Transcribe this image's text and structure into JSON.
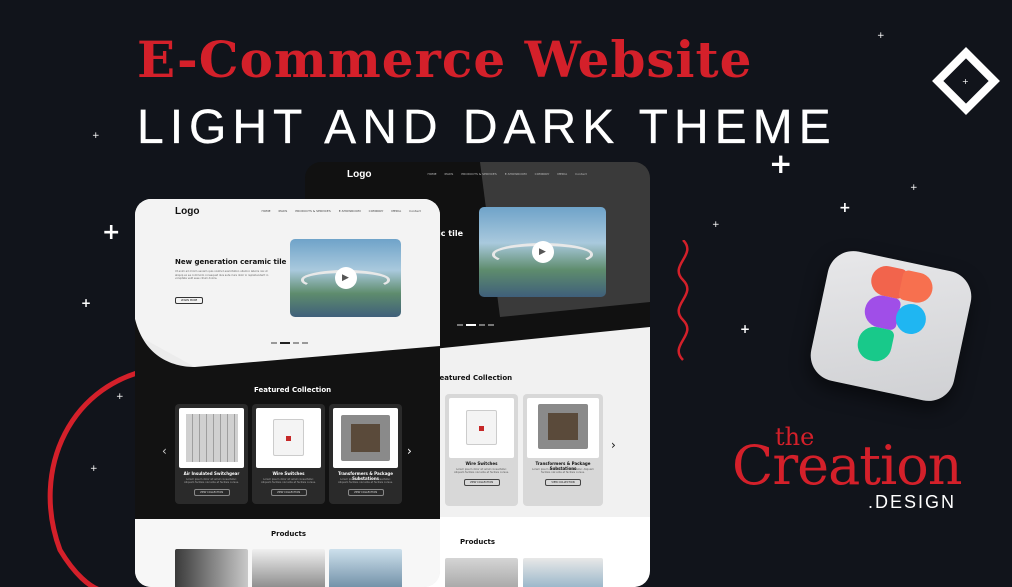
{
  "headline": {
    "line1": "E-Commerce Website",
    "line2": "LIGHT AND DARK THEME"
  },
  "brand": {
    "the": "the",
    "creation": "Creation",
    "design": ".DESIGN"
  },
  "dark_mockup": {
    "logo": "Logo",
    "nav": [
      "HOME",
      "IPADS",
      "PRODUCTS & SERVICES",
      "E-SHOWROOM",
      "COMPANY",
      "MEDIA",
      "Contact"
    ],
    "hero_title_partial": "ic tile",
    "featured_title": "Featured Collection",
    "cards": [
      {
        "title": "Wire Switches",
        "desc": "Lorem ipsum dolor sit amet consectetur. Aliquam facilisis nisl ante et facilisis cursus.",
        "button": "VIEW COLLECTION"
      },
      {
        "title": "Transformers & Package Substations",
        "desc": "Lorem ipsum dolor sit amet consectetur. Aliquam facilisis nisl ante et facilisis cursus.",
        "button": "VIEW COLLECTION"
      }
    ],
    "next_arrow": "›",
    "products_title": "Products"
  },
  "light_mockup": {
    "logo": "Logo",
    "nav": [
      "HOME",
      "IPADS",
      "PRODUCTS & SERVICES",
      "E-SHOWROOM",
      "COMPANY",
      "MEDIA",
      "Contact"
    ],
    "hero_title": "New generation ceramic tile",
    "hero_desc": "Ut enim ad minim veniam quis nostrud exercitation ullamco laboris nisi ut aliquip ex ea commodo consequat duis aute irure dolor in reprehenderit in voluptate velit esse cillum dolore.",
    "hero_button": "LEARN MORE",
    "featured_title": "Featured Collection",
    "cards": [
      {
        "title": "Air Insulated Switchgear",
        "desc": "Lorem ipsum dolor sit amet consectetur. Aliquam facilisis nisl ante et facilisis cursus.",
        "button": "VIEW COLLECTION"
      },
      {
        "title": "Wire Switches",
        "desc": "Lorem ipsum dolor sit amet consectetur. Aliquam facilisis nisl ante et facilisis cursus.",
        "button": "VIEW COLLECTION"
      },
      {
        "title": "Transformers & Package Substations",
        "desc": "Lorem ipsum dolor sit amet consectetur. Aliquam facilisis nisl ante et facilisis cursus.",
        "button": "VIEW COLLECTION"
      }
    ],
    "prev_arrow": "‹",
    "next_arrow": "›",
    "products_title": "Products"
  },
  "colors": {
    "accent": "#d4202a",
    "background": "#11141b",
    "dark_card": "#2a2a2a",
    "light_card": "#ececec"
  },
  "icons": [
    "plus-sparkle-icon",
    "diamond-icon",
    "figma-logo-icon",
    "play-icon"
  ]
}
